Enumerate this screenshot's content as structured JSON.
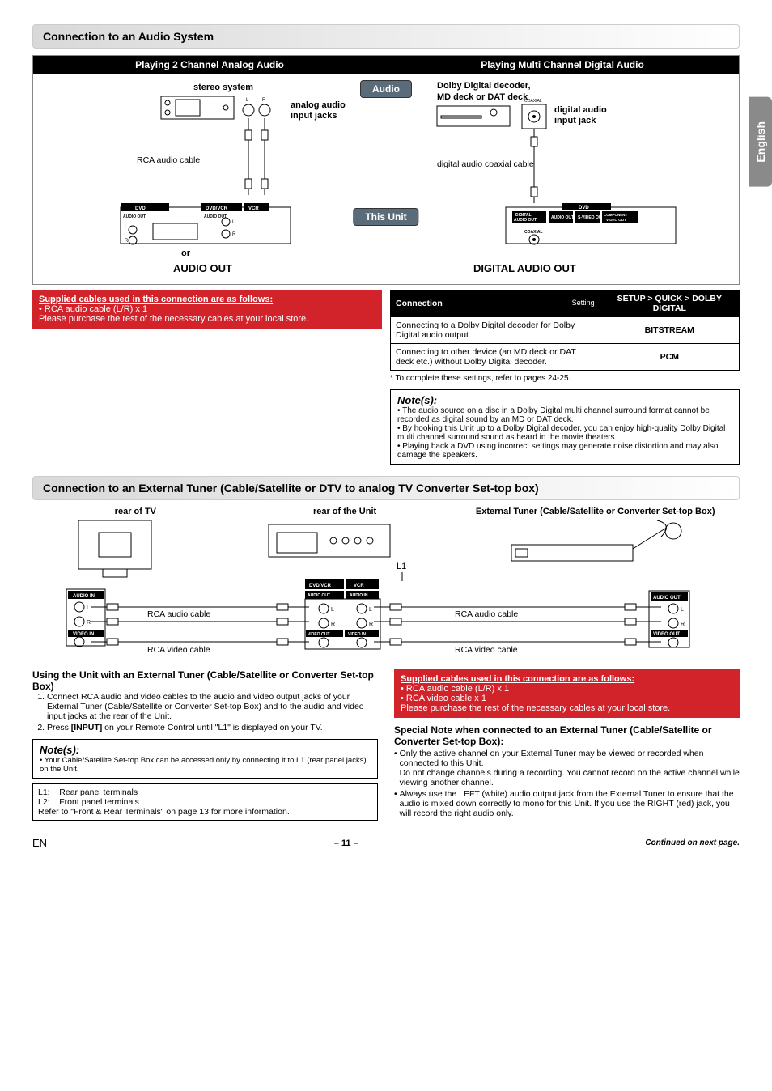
{
  "lang_tab": "English",
  "section1": {
    "header": "Connection to an Audio System",
    "left_title": "Playing 2 Channel Analog Audio",
    "right_title": "Playing Multi Channel Digital Audio",
    "stereo_system": "stereo system",
    "analog_jacks_l1": "analog audio",
    "analog_jacks_l2": "input jacks",
    "rca_cable": "RCA audio cable",
    "or": "or",
    "audio_out": "AUDIO OUT",
    "audio_badge": "Audio",
    "unit_badge": "This Unit",
    "dolby_decoder_l1": "Dolby Digital decoder,",
    "dolby_decoder_l2": "MD deck or DAT deck",
    "digital_jack_l1": "digital audio",
    "digital_jack_l2": "input jack",
    "digital_cable": "digital audio coaxial cable",
    "digital_audio_out": "DIGITAL AUDIO OUT",
    "red_header": "Supplied cables used in this connection are as follows:",
    "red_l1": "• RCA audio cable (L/R) x 1",
    "red_l2": "Please purchase the rest of the necessary cables at your local store.",
    "table": {
      "th_connection": "Connection",
      "th_setting_pre": "Setting",
      "th_setting": "SETUP > QUICK > DOLBY DIGITAL",
      "r1c1": "Connecting to a Dolby Digital decoder for Dolby Digital audio output.",
      "r1c2": "BITSTREAM",
      "r2c1": "Connecting to other device (an MD deck or DAT deck etc.) without Dolby Digital decoder.",
      "r2c2": "PCM"
    },
    "footnote": "* To complete these settings, refer to pages 24-25.",
    "notes_title": "Note(s):",
    "notes": [
      "The audio source on a disc in a Dolby Digital multi channel surround format cannot be recorded as digital sound by an MD or DAT deck.",
      "By hooking this Unit up to a Dolby Digital decoder, you can enjoy high-quality Dolby Digital multi channel surround sound as heard in the movie theaters.",
      "Playing back a DVD using incorrect settings may generate noise distortion and may also damage the speakers."
    ]
  },
  "section2": {
    "header": "Connection to an External Tuner (Cable/Satellite or DTV to analog TV Converter Set-top box)",
    "rear_tv": "rear of TV",
    "rear_unit": "rear of the Unit",
    "ext_tuner": "External Tuner (Cable/Satellite or Converter Set-top Box)",
    "l1_label": "L1",
    "rca_audio": "RCA audio cable",
    "rca_video": "RCA video cable",
    "using_title": "Using the Unit with an External Tuner (Cable/Satellite or Converter Set-top Box)",
    "step1": "Connect RCA audio and video cables to the audio and video output jacks of your External Tuner (Cable/Satellite or Converter Set-top Box) and to the audio and video input jacks at the rear of the Unit.",
    "step2_pre": "Press ",
    "step2_bold": "[INPUT]",
    "step2_post": " on your Remote Control until \"L1\" is displayed on your TV.",
    "notes_title": "Note(s):",
    "note1": "Your Cable/Satellite Set-top Box can be accessed only by connecting it to L1 (rear panel jacks) on the Unit.",
    "lterm_l1": "L1:    Rear panel terminals",
    "lterm_l2": "L2:    Front panel terminals",
    "lterm_ref": "Refer to \"Front & Rear Terminals\" on page 13 for more information.",
    "red_header": "Supplied cables used in this connection are as follows:",
    "red_l1": "• RCA audio cable (L/R) x 1",
    "red_l2": "• RCA video cable x 1",
    "red_l3": "Please purchase the rest of the necessary cables at your local store.",
    "special_title": "Special Note when connected to an External Tuner (Cable/Satellite or Converter Set-top Box):",
    "special_b1a": "Only the active channel on your External Tuner may be viewed or recorded when connected to this Unit.",
    "special_b1b": "Do not change channels during a recording. You cannot record on the active channel while viewing another channel.",
    "special_b2": "Always use the LEFT (white) audio output jack from the External Tuner to ensure that the audio is mixed down correctly to mono for this Unit. If you use the RIGHT (red) jack, you will record the right audio only."
  },
  "footer": {
    "en": "EN",
    "page": "– 11 –",
    "cont": "Continued on next page."
  }
}
